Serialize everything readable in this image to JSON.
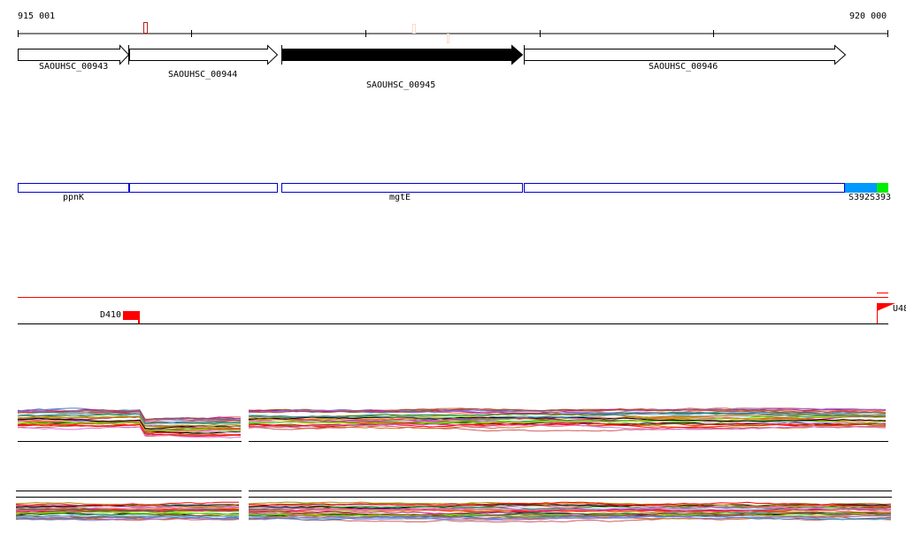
{
  "ruler": {
    "start_label": "915 001",
    "end_label": "920 000"
  },
  "genes": [
    {
      "name": "SAOUHSC_00943",
      "filled": false
    },
    {
      "name": "SAOUHSC_00944",
      "filled": false
    },
    {
      "name": "SAOUHSC_00945",
      "filled": true
    },
    {
      "name": "SAOUHSC_00946",
      "filled": false
    }
  ],
  "operons": [
    {
      "label": "ppnK",
      "color": "#0000cc"
    },
    {
      "label": "",
      "color": "#0000cc"
    },
    {
      "label": "mgtE",
      "color": "#0000cc"
    },
    {
      "label": "",
      "color": "#0000cc"
    },
    {
      "label": "S392",
      "color": "#0099ff"
    },
    {
      "label": "S393",
      "color": "#00ee00"
    }
  ],
  "features": {
    "left_label": "D410",
    "right_label": "U48",
    "color": "#ff0000"
  },
  "trace_palette": [
    "#808000",
    "#7cfc00",
    "#cd5c5c",
    "#ff6347",
    "#87ceeb",
    "#c71585",
    "#d2691e",
    "#000000",
    "#9370db",
    "#b8860b",
    "#228b22",
    "#ff0000",
    "#da70d6",
    "#4682b4",
    "#a0522d"
  ]
}
